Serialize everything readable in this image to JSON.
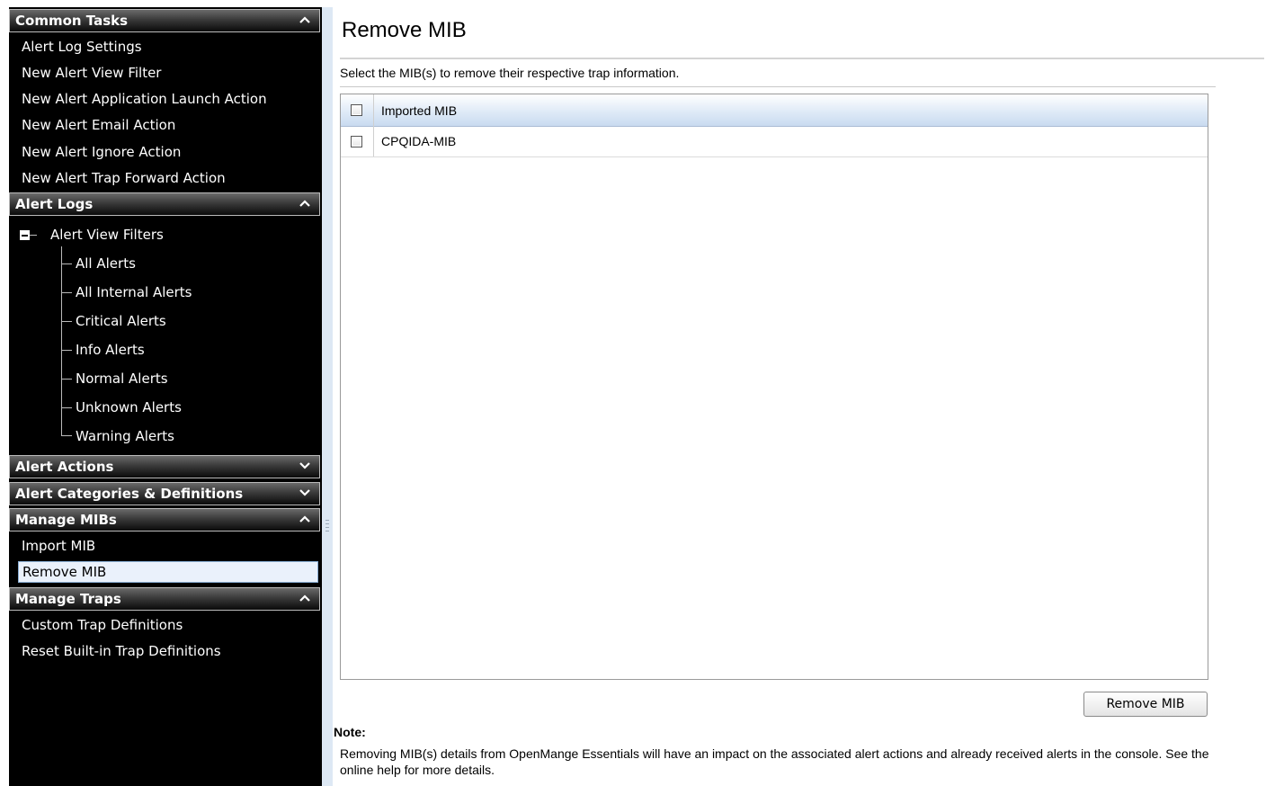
{
  "sidebar": {
    "common_tasks": {
      "title": "Common Tasks",
      "items": [
        "Alert Log Settings",
        "New Alert View Filter",
        "New Alert Application Launch Action",
        "New Alert Email Action",
        "New Alert Ignore Action",
        "New Alert Trap Forward Action"
      ]
    },
    "alert_logs": {
      "title": "Alert Logs",
      "tree_root": "Alert View Filters",
      "tree_items": [
        "All Alerts",
        "All Internal Alerts",
        "Critical Alerts",
        "Info Alerts",
        "Normal Alerts",
        "Unknown Alerts",
        "Warning Alerts"
      ]
    },
    "alert_actions": {
      "title": "Alert Actions"
    },
    "alert_categories": {
      "title": "Alert Categories & Definitions"
    },
    "manage_mibs": {
      "title": "Manage MIBs",
      "items": [
        "Import MIB",
        "Remove MIB"
      ],
      "selected": "Remove MIB"
    },
    "manage_traps": {
      "title": "Manage Traps",
      "items": [
        "Custom Trap Definitions",
        "Reset Built-in Trap Definitions"
      ]
    }
  },
  "main": {
    "title": "Remove MIB",
    "description": "Select the MIB(s) to remove their respective trap information.",
    "grid": {
      "column_header": "Imported MIB",
      "rows": [
        {
          "name": "CPQIDA-MIB",
          "checked": false
        }
      ]
    },
    "remove_button": "Remove MIB",
    "note_label": "Note:",
    "note_text": "Removing MIB(s) details from OpenMange Essentials will have an impact on the associated alert actions and already received alerts in the console. See the online help for more details."
  },
  "icons": {
    "expanded": "chevron-up-icon",
    "collapsed": "chevron-down-icon",
    "tree_toggle": "collapse-minus-icon",
    "splitter": "splitter-grip-icon"
  }
}
